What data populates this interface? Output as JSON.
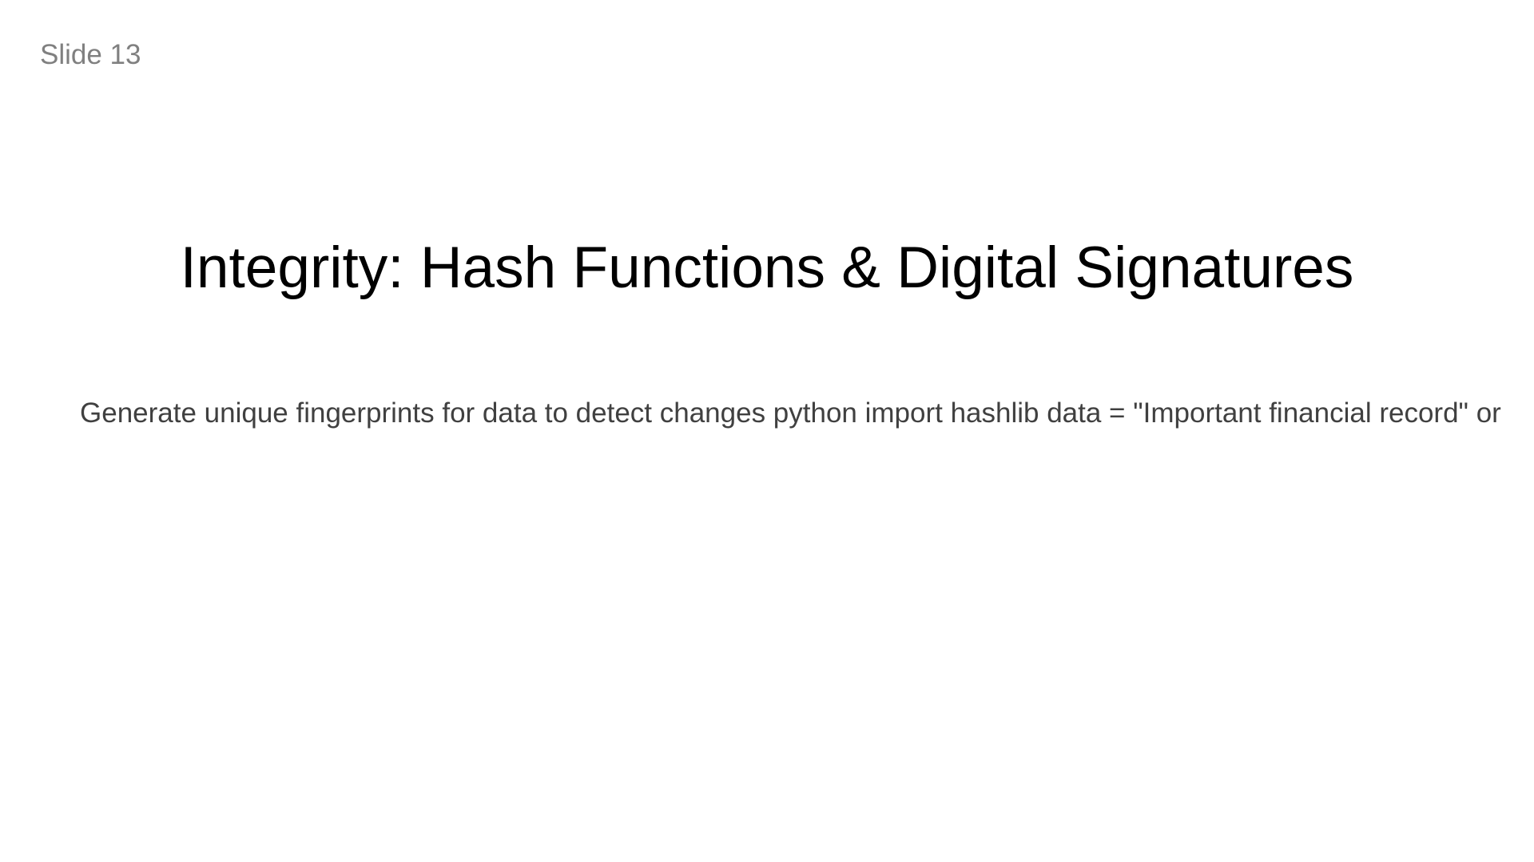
{
  "slide": {
    "number_label": "Slide 13",
    "title": "Integrity: Hash Functions & Digital Signatures",
    "body": "Generate unique fingerprints for data to detect changes python import hashlib data = \"Important financial record\" or"
  }
}
